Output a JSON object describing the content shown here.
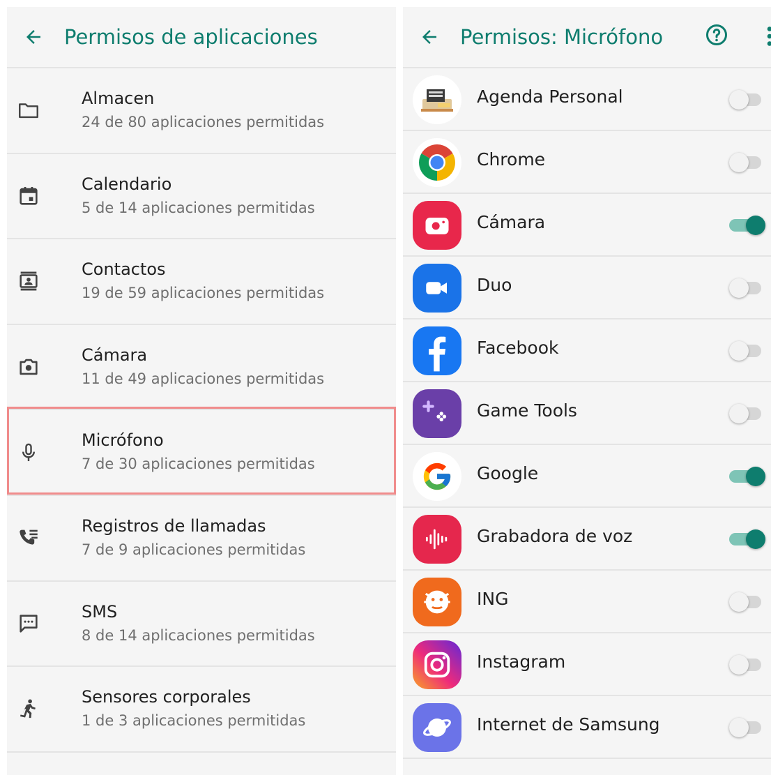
{
  "left": {
    "title": "Permisos de aplicaciones",
    "items": [
      {
        "title": "Almacen",
        "subtitle": "24 de 80 aplicaciones permitidas",
        "icon": "folder-icon"
      },
      {
        "title": "Calendario",
        "subtitle": "5 de 14 aplicaciones permitidas",
        "icon": "calendar-icon"
      },
      {
        "title": "Contactos",
        "subtitle": "19 de 59 aplicaciones permitidas",
        "icon": "contacts-icon"
      },
      {
        "title": "Cámara",
        "subtitle": "11 de 49 aplicaciones permitidas",
        "icon": "camera-icon"
      },
      {
        "title": "Micrófono",
        "subtitle": "7 de 30 aplicaciones permitidas",
        "icon": "microphone-icon",
        "highlighted": true
      },
      {
        "title": "Registros de llamadas",
        "subtitle": "7 de 9 aplicaciones permitidas",
        "icon": "call-log-icon"
      },
      {
        "title": "SMS",
        "subtitle": "8 de 14 aplicaciones permitidas",
        "icon": "sms-icon"
      },
      {
        "title": "Sensores corporales",
        "subtitle": "1 de 3 aplicaciones permitidas",
        "icon": "body-sensors-icon"
      }
    ]
  },
  "right": {
    "title": "Permisos: Micrófono",
    "help_icon": "help-icon",
    "more_icon": "more-options-icon",
    "apps": [
      {
        "name": "Agenda Personal",
        "enabled": false,
        "icon": "agenda-personal-icon"
      },
      {
        "name": "Chrome",
        "enabled": false,
        "icon": "chrome-icon"
      },
      {
        "name": "Cámara",
        "enabled": true,
        "icon": "camera-app-icon"
      },
      {
        "name": "Duo",
        "enabled": false,
        "icon": "duo-icon"
      },
      {
        "name": "Facebook",
        "enabled": false,
        "icon": "facebook-icon"
      },
      {
        "name": "Game Tools",
        "enabled": false,
        "icon": "game-tools-icon"
      },
      {
        "name": "Google",
        "enabled": true,
        "icon": "google-icon"
      },
      {
        "name": "Grabadora de voz",
        "enabled": true,
        "icon": "voice-recorder-icon"
      },
      {
        "name": "ING",
        "enabled": false,
        "icon": "ing-icon"
      },
      {
        "name": "Instagram",
        "enabled": false,
        "icon": "instagram-icon"
      },
      {
        "name": "Internet de Samsung",
        "enabled": false,
        "icon": "samsung-internet-icon"
      }
    ]
  },
  "colors": {
    "accent": "#0e7d6e",
    "highlight_border": "#f08c8c",
    "panel_bg": "#f5f5f5",
    "divider": "#e4e4e4",
    "subtitle_text": "#6f6f6f"
  }
}
